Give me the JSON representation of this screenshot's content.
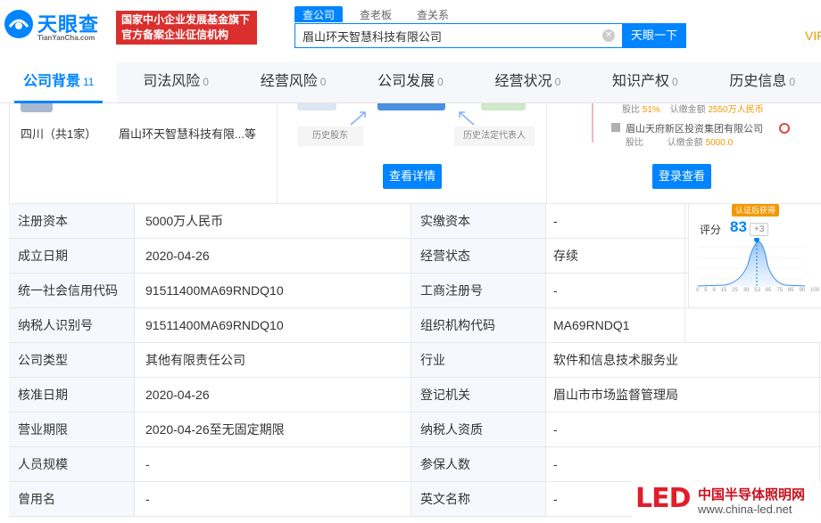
{
  "header": {
    "logo_text": "天眼查",
    "logo_sub": "TianYanCha.com",
    "banner_line1": "国家中小企业发展基金旗下",
    "banner_line2": "官方备案企业征信机构",
    "search_tabs": [
      "查公司",
      "查老板",
      "查关系"
    ],
    "search_value": "眉山环天智慧科技有限公司",
    "search_button": "天眼一下",
    "vip": "VIF"
  },
  "nav": [
    {
      "label": "公司背景",
      "count": "11"
    },
    {
      "label": "司法风险",
      "count": "0"
    },
    {
      "label": "经营风险",
      "count": "0"
    },
    {
      "label": "公司发展",
      "count": "0"
    },
    {
      "label": "经营状况",
      "count": "0"
    },
    {
      "label": "知识产权",
      "count": "0"
    },
    {
      "label": "历史信息",
      "count": "0"
    }
  ],
  "cards": {
    "branch_region": "四川（共1家）",
    "branch_name": "眉山环天智慧科技有限...等",
    "history_shareholder": "历史股东",
    "history_legal_rep": "历史法定代表人",
    "view_detail": "查看详情",
    "holder_line1_prefix": "股比",
    "holder_line1_ratio": "51%",
    "holder_line1_amount_label": "认缴金额",
    "holder_line1_amount": "2550万人民币",
    "holder2_name": "眉山天府新区投资集团有限公司",
    "holder2_ratio_label": "股比",
    "holder2_amount_label": "认缴金额",
    "holder2_amount": "5000.0",
    "login_view": "登录查看"
  },
  "table": [
    {
      "l1": "注册资本",
      "v1": "5000万人民币",
      "l2": "实缴资本",
      "v2": "-"
    },
    {
      "l1": "成立日期",
      "v1": "2020-04-26",
      "l2": "经营状态",
      "v2": "存续"
    },
    {
      "l1": "统一社会信用代码",
      "v1": "91511400MA69RNDQ10",
      "l2": "工商注册号",
      "v2": "-"
    },
    {
      "l1": "纳税人识别号",
      "v1": "91511400MA69RNDQ10",
      "l2": "组织机构代码",
      "v2": "MA69RNDQ1"
    },
    {
      "l1": "公司类型",
      "v1": "其他有限责任公司",
      "l2": "行业",
      "v2": "软件和信息技术服务业"
    },
    {
      "l1": "核准日期",
      "v1": "2020-04-26",
      "l2": "登记机关",
      "v2": "眉山市市场监督管理局"
    },
    {
      "l1": "营业期限",
      "v1": "2020-04-26至无固定期限",
      "l2": "纳税人资质",
      "v2": "-"
    },
    {
      "l1": "人员规模",
      "v1": "-",
      "l2": "参保人数",
      "v2": "-"
    },
    {
      "l1": "曾用名",
      "v1": "-",
      "l2": "英文名称",
      "v2": "-"
    }
  ],
  "score": {
    "badge": "认证后获得",
    "label": "评分",
    "value": "83",
    "delta": "+3",
    "axis_ticks": [
      "0",
      "5",
      "9",
      "15",
      "25",
      "39",
      "53",
      "65",
      "75",
      "85",
      "90",
      "100"
    ]
  },
  "watermark": {
    "led": "LED",
    "cn": "中国半导体照明网",
    "url": "www.china-led.net"
  },
  "colors": {
    "brand": "#0084ff",
    "banner": "#d9302e",
    "vip": "#f39800",
    "label_bg": "#f5f8fc"
  }
}
